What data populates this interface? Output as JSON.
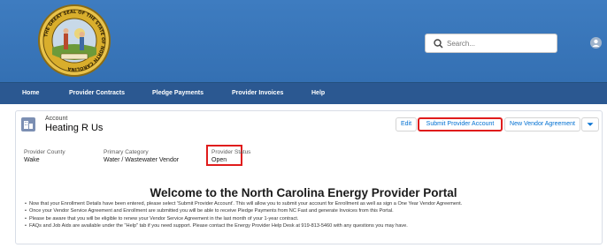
{
  "header": {
    "search": {
      "placeholder": "Search..."
    },
    "seal_text": "THE GREAT SEAL OF THE STATE OF NORTH CAROLINA"
  },
  "nav": {
    "items": [
      {
        "label": "Home"
      },
      {
        "label": "Provider Contracts"
      },
      {
        "label": "Pledge Payments"
      },
      {
        "label": "Provider Invoices"
      },
      {
        "label": "Help"
      }
    ]
  },
  "record": {
    "type_label": "Account",
    "name": "Heating R Us",
    "actions": {
      "edit": "Edit",
      "submit": "Submit Provider Account",
      "new_vendor": "New Vendor Agreement"
    },
    "fields": [
      {
        "label": "Provider County",
        "value": "Wake"
      },
      {
        "label": "Primary Category",
        "value": "Water / Wastewater Vendor"
      },
      {
        "label": "Provider Status",
        "value": "Open"
      }
    ]
  },
  "welcome": {
    "title": "Welcome to the North Carolina Energy Provider Portal",
    "bullets": [
      "Now that your Enrollment Details have been entered, please select 'Submit Provider Account'. This will allow you to submit your account for Enrollment as well as sign a One Year Vendor Agreement.",
      "Once your Vendor Service Agreement and Enrollment are submitted you will be able to receive Pledge Payments from NC Fast and generate Invoices from this Portal.",
      "Please be aware that you will be eligible to renew your Vendor Service Agreement in the last month of your 1-year contract.",
      "FAQs and Job Aids are available under the \"Help\" tab if you need support. Please contact the Energy Provider Help Desk at 919-813-5460 with any questions you may have."
    ]
  },
  "colors": {
    "banner": "#3a77bb",
    "nav": "#2b5891",
    "highlight": "#e01c1c",
    "link": "#0070d2"
  }
}
